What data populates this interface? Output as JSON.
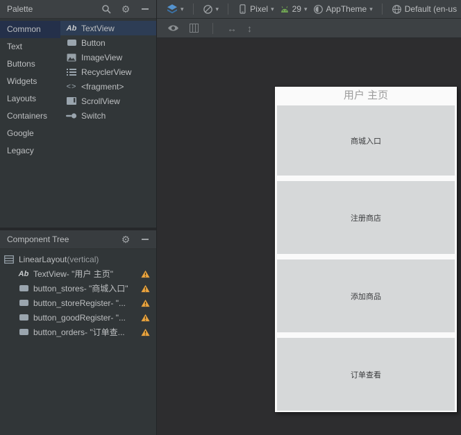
{
  "icons": {
    "gear": "⚙",
    "dropdown": "▾",
    "h_scroll": "↔",
    "v_scroll": "↕"
  },
  "palette": {
    "title": "Palette",
    "categories": [
      {
        "label": "Common"
      },
      {
        "label": "Text"
      },
      {
        "label": "Buttons"
      },
      {
        "label": "Widgets"
      },
      {
        "label": "Layouts"
      },
      {
        "label": "Containers"
      },
      {
        "label": "Google"
      },
      {
        "label": "Legacy"
      }
    ],
    "items": [
      {
        "label": "TextView",
        "glyph": "Ab"
      },
      {
        "label": "Button"
      },
      {
        "label": "ImageView"
      },
      {
        "label": "RecyclerView"
      },
      {
        "label": "<fragment>",
        "glyph": "<>"
      },
      {
        "label": "ScrollView"
      },
      {
        "label": "Switch"
      }
    ]
  },
  "toolbar": {
    "device": "Pixel",
    "api_level": "29",
    "theme": "AppTheme",
    "locale": "Default (en-us"
  },
  "component_tree": {
    "title": "Component Tree",
    "root_label": "LinearLayout",
    "root_suffix": "(vertical)",
    "textview_glyph": "Ab",
    "nodes": [
      {
        "label": "TextView- \"用户 主页\""
      },
      {
        "label": "button_stores- \"商城入口\""
      },
      {
        "label": "button_storeRegister- \"..."
      },
      {
        "label": "button_goodRegister- \"..."
      },
      {
        "label": "button_orders- \"订单查..."
      }
    ]
  },
  "canvas": {
    "title": "用户 主页",
    "buttons": [
      {
        "label": "商城入口"
      },
      {
        "label": "注册商店"
      },
      {
        "label": "添加商品"
      },
      {
        "label": "订单查看"
      }
    ]
  }
}
